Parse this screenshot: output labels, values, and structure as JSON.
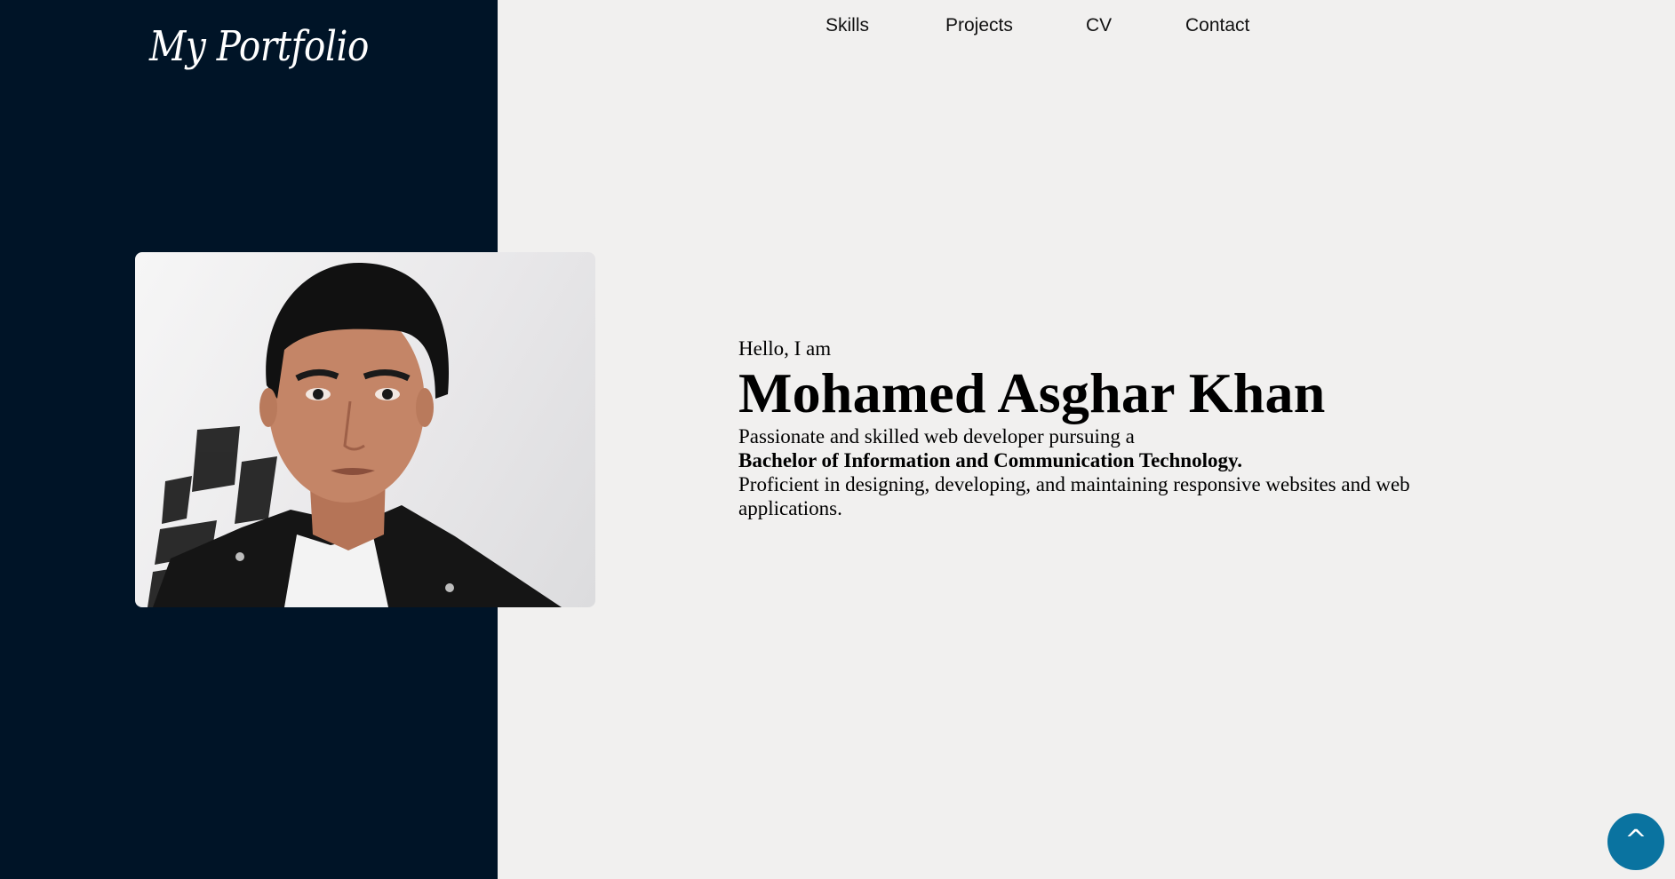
{
  "brand": {
    "logo_text": "My Portfolio"
  },
  "nav": {
    "items": [
      {
        "label": "Skills"
      },
      {
        "label": "Projects"
      },
      {
        "label": "CV"
      },
      {
        "label": "Contact"
      }
    ]
  },
  "hero": {
    "greeting": "Hello, I am",
    "name": "Mohamed Asghar Khan",
    "bio_intro": "Passionate and skilled web developer pursuing a",
    "bio_degree": "Bachelor of Information and Communication Technology.",
    "bio_rest": "Proficient in designing, developing, and maintaining responsive websites and web applications."
  },
  "scroll_top": {
    "label": "^"
  },
  "colors": {
    "sidebar": "#001427",
    "page_background": "#f1f0ef",
    "accent": "#0a73a0"
  }
}
